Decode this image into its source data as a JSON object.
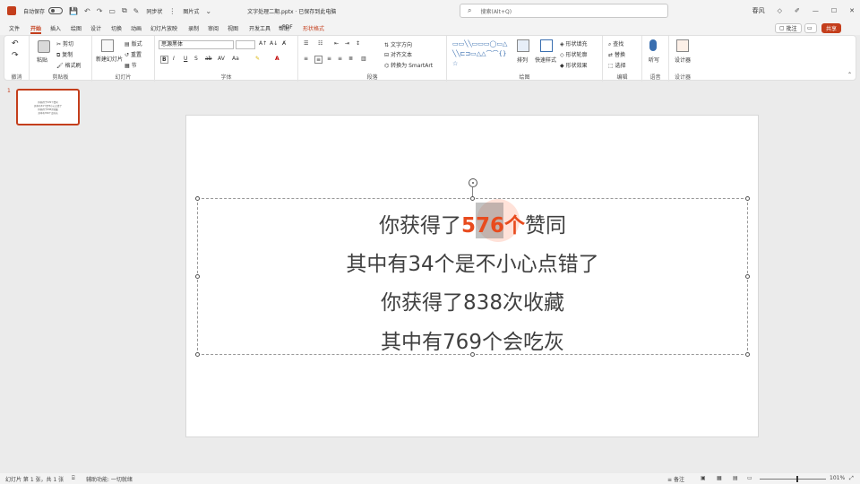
{
  "titlebar": {
    "autosave": "自动保存",
    "file_title": "文字处理二期.pptx · 已保存到此电脑",
    "search_placeholder": "搜索(Alt+Q)",
    "user": "春风",
    "sync_label": "同步状",
    "pic_label": "图片式"
  },
  "menu": {
    "tabs": [
      "文件",
      "开始",
      "插入",
      "绘图",
      "设计",
      "切换",
      "动画",
      "幻灯片放映",
      "录制",
      "审阅",
      "视图",
      "开发工具",
      "帮助",
      "PDF",
      "形状格式"
    ],
    "active": "开始",
    "comment_label": "批注",
    "share_label": "共享"
  },
  "ribbon": {
    "groups": [
      {
        "label": "撤消"
      },
      {
        "label": "剪贴板"
      },
      {
        "label": "幻灯片"
      },
      {
        "label": "字体"
      },
      {
        "label": "段落"
      },
      {
        "label": "绘图"
      },
      {
        "label": "编辑"
      },
      {
        "label": "语音"
      },
      {
        "label": "设计器"
      }
    ],
    "clipboard": {
      "paste": "粘贴",
      "cut": "剪切",
      "copy": "复制",
      "format_painter": "格式刷"
    },
    "slides": {
      "new_slide": "新建幻灯片",
      "layout": "版式",
      "reset": "重置",
      "section": "节"
    },
    "font": {
      "font_name": "思源黑体",
      "font_size": ""
    },
    "paragraph": {
      "text_direction": "文字方向",
      "align_text": "对齐文本",
      "smartart": "转换为 SmartArt"
    },
    "drawing": {
      "arrange": "排列",
      "quick_styles": "快速样式",
      "fill": "形状填充",
      "outline": "形状轮廓",
      "effects": "形状效果"
    },
    "editing": {
      "find": "查找",
      "replace": "替换",
      "select": "选择"
    },
    "voice": {
      "dictate": "听写"
    },
    "designer": {
      "designer": "设计器"
    }
  },
  "thumbnails": {
    "number": "1",
    "lines": [
      "你获得了576个赞同",
      "其中有34个是不小心点错了",
      "你获得了838次收藏",
      "其中有769个会吃灰"
    ]
  },
  "slide": {
    "line1_pre": "你获得了",
    "line1_hl": "576个",
    "line1_post": "赞同",
    "line2": "其中有34个是不小心点错了",
    "line3": "你获得了838次收藏",
    "line4": "其中有769个会吃灰",
    "highlight_color": "#e84b1e"
  },
  "status": {
    "slide_count": "幻灯片 第 1 张，共 1 张",
    "accessibility": "辅助功能: 一切就绪",
    "notes": "备注",
    "zoom": "101%"
  }
}
